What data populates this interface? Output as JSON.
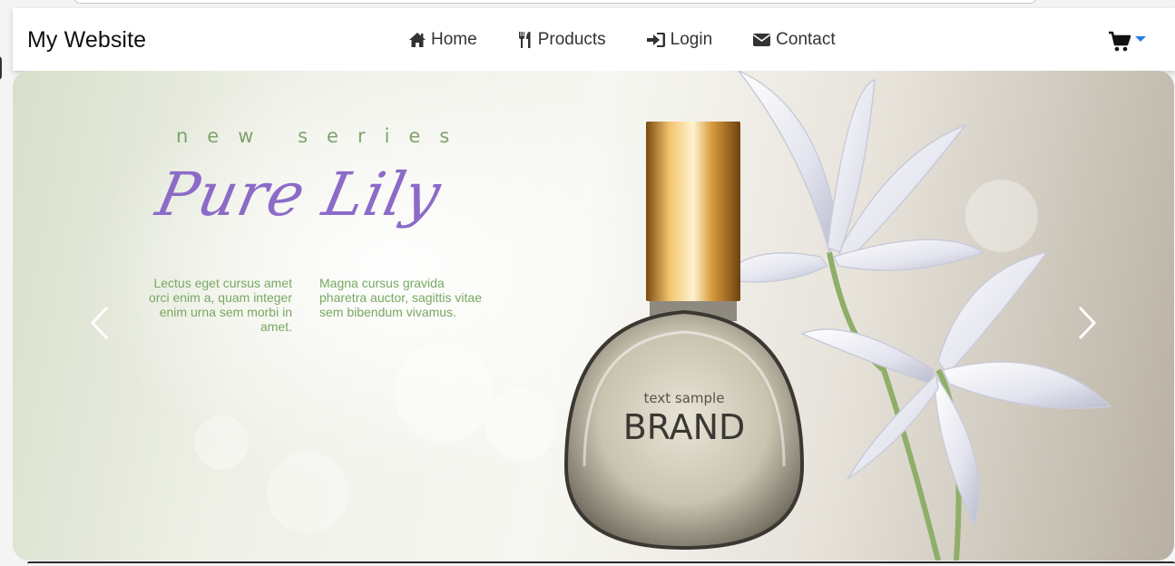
{
  "navbar": {
    "brand": "My Website",
    "links": [
      {
        "label": "Home",
        "icon": "home-icon"
      },
      {
        "label": "Products",
        "icon": "cutlery-icon"
      },
      {
        "label": "Login",
        "icon": "sign-in-icon"
      },
      {
        "label": "Contact",
        "icon": "envelope-icon"
      }
    ],
    "cart_icon": "shopping-cart-icon",
    "accent": "#2f7de0"
  },
  "carousel": {
    "slide": {
      "eyebrow": "new series",
      "headline": "Pure Lily",
      "text_left": "Lectus eget cursus amet orci enim a, quam integer enim urna sem morbi in amet.",
      "text_right": "Magna cursus gravida pharetra auctor, sagittis vitae sem bibendum vivamus.",
      "bottle_caption": "text sample",
      "bottle_brand": "BRAND"
    },
    "prev_icon": "chevron-left-icon",
    "next_icon": "chevron-right-icon"
  }
}
